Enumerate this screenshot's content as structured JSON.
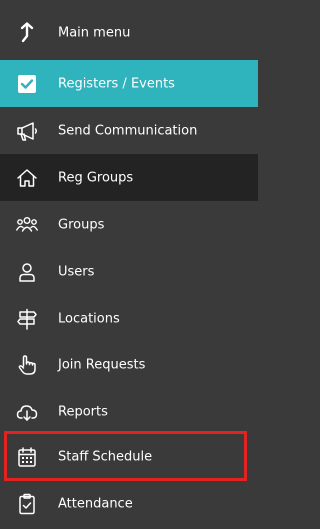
{
  "menu": {
    "items": [
      {
        "label": "Main menu",
        "icon": "up-arrow-icon"
      },
      {
        "label": "Registers / Events",
        "icon": "checkbox-icon"
      },
      {
        "label": "Send Communication",
        "icon": "megaphone-icon"
      },
      {
        "label": "Reg Groups",
        "icon": "home-icon"
      },
      {
        "label": "Groups",
        "icon": "people-group-icon"
      },
      {
        "label": "Users",
        "icon": "user-icon"
      },
      {
        "label": "Locations",
        "icon": "signpost-icon"
      },
      {
        "label": "Join Requests",
        "icon": "pointing-hand-icon"
      },
      {
        "label": "Reports",
        "icon": "cloud-download-icon"
      },
      {
        "label": "Staff Schedule",
        "icon": "calendar-icon"
      },
      {
        "label": "Attendance",
        "icon": "clipboard-check-icon"
      }
    ]
  },
  "colors": {
    "background": "#3a3a3a",
    "active": "#2fb3bd",
    "dark_row": "#232323",
    "highlight_border": "#e32222"
  }
}
